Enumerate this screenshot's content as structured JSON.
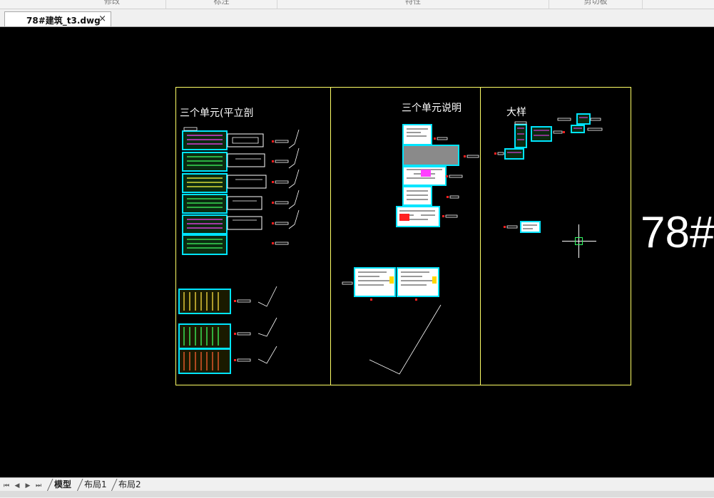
{
  "ribbon": {
    "groups": [
      "修改",
      "标注",
      "特性",
      "剪切板"
    ]
  },
  "document_tab": {
    "title": "78#建筑_t3.dwg",
    "close_glyph": "×"
  },
  "drawing": {
    "panel_titles": [
      "三个单元(平立剖",
      "三个单元说明",
      "大样"
    ],
    "big_label": "78#",
    "colors": {
      "background": "#000000",
      "frame": "#ffff66",
      "sheet": "#00e5ff",
      "text": "#ffffff",
      "marker": "#ff2020",
      "crosshair": "#ffffff",
      "pickbox": "#33ff66"
    }
  },
  "layout_tabs": {
    "nav": [
      "⏮",
      "◀",
      "▶",
      "⏭"
    ],
    "tabs": [
      "模型",
      "布局1",
      "布局2"
    ],
    "active": "模型"
  }
}
